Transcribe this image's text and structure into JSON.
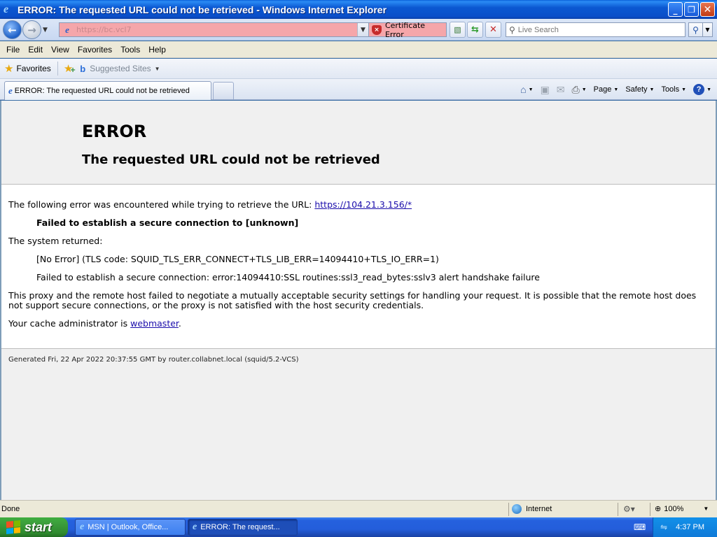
{
  "window": {
    "title": "ERROR: The requested URL could not be retrieved - Windows Internet Explorer",
    "minimize": "_",
    "restore": "❐",
    "close": "✕"
  },
  "address": {
    "url": "https://bc.vcl7",
    "cert_error": "Certificate Error",
    "search_placeholder": "Live Search"
  },
  "menu": [
    "File",
    "Edit",
    "View",
    "Favorites",
    "Tools",
    "Help"
  ],
  "favorites_bar": {
    "favorites": "Favorites",
    "suggested_sites": "Suggested Sites"
  },
  "tab": {
    "label": "ERROR: The requested URL could not be retrieved"
  },
  "command_bar": {
    "page": "Page",
    "safety": "Safety",
    "tools": "Tools"
  },
  "page": {
    "heading": "ERROR",
    "subheading": "The requested URL could not be retrieved",
    "intro": "The following error was encountered while trying to retrieve the URL: ",
    "intro_link": "https://104.21.3.156/*",
    "failed_secure": "Failed to establish a secure connection to [unknown]",
    "system_returned": "The system returned:",
    "tls_code": "[No Error] (TLS code: SQUID_TLS_ERR_CONNECT+TLS_LIB_ERR=14094410+TLS_IO_ERR=1)",
    "ssl_error": "Failed to establish a secure connection: error:14094410:SSL routines:ssl3_read_bytes:sslv3 alert handshake failure",
    "explanation": "This proxy and the remote host failed to negotiate a mutually acceptable security settings for handling your request. It is possible that the remote host does not support secure connections, or the proxy is not satisfied with the host security credentials.",
    "admin_prefix": "Your cache administrator is ",
    "admin_link": "webmaster",
    "admin_suffix": ".",
    "generated": "Generated Fri, 22 Apr 2022 20:37:55 GMT by router.collabnet.local (squid/5.2-VCS)"
  },
  "status": {
    "text": "Done",
    "zone": "Internet",
    "zoom": "100%"
  },
  "taskbar": {
    "start": "start",
    "tasks": [
      "MSN | Outlook, Office...",
      "ERROR: The request..."
    ],
    "clock": "4:37 PM"
  },
  "colors": {
    "address_error_bg": "#f5a6aa",
    "link": "#1a0dab",
    "taskbar": "#245edb",
    "start_button": "#3c9e3c"
  },
  "icons": [
    "ie-icon",
    "back-arrow-icon",
    "forward-arrow-icon",
    "certificate-error-shield-icon",
    "compatibility-icon",
    "refresh-icon",
    "stop-icon",
    "search-icon",
    "favorites-star-icon",
    "add-favorites-icon",
    "bing-icon",
    "home-icon",
    "feeds-icon",
    "mail-icon",
    "print-icon",
    "help-icon",
    "globe-icon",
    "windows-flag-icon"
  ]
}
